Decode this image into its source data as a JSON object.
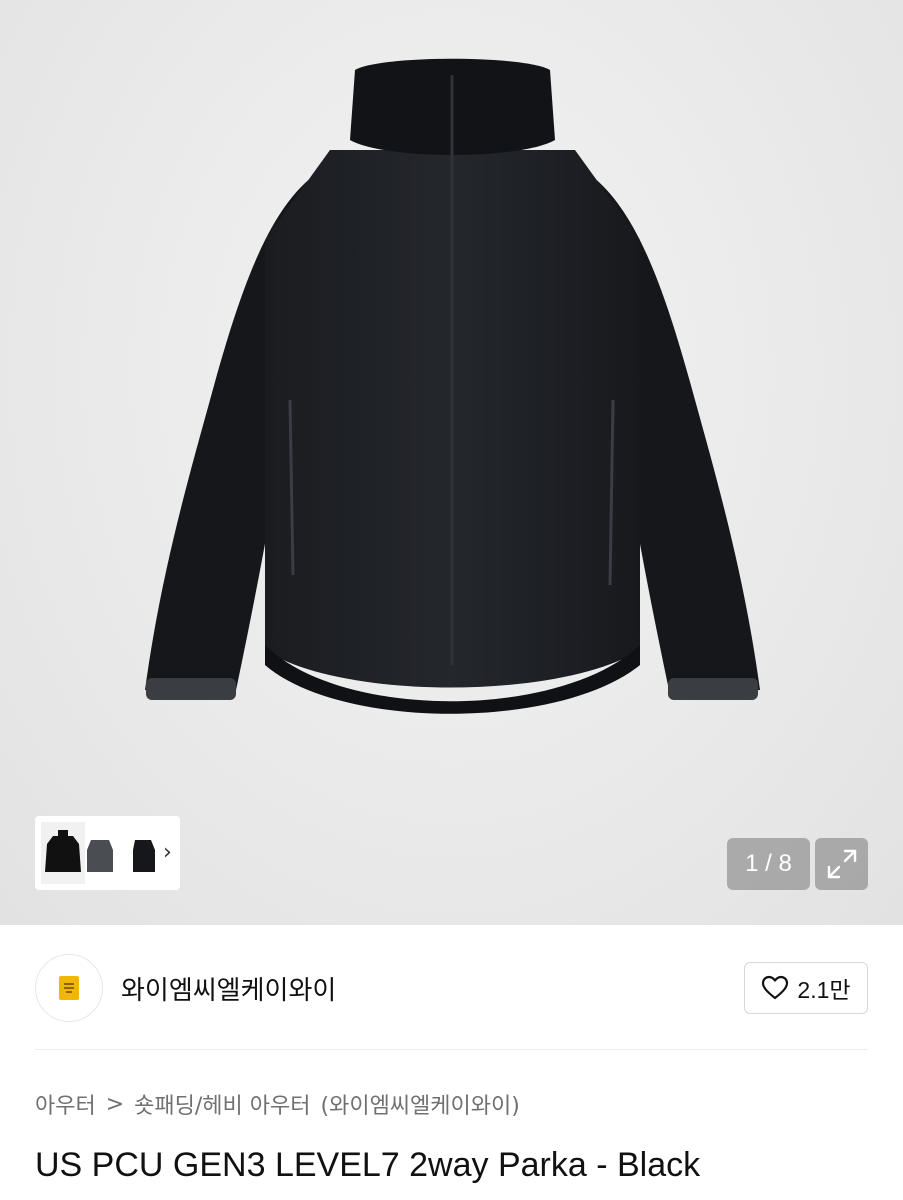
{
  "gallery": {
    "counter": "1 / 8",
    "thumbnails": [
      "jacket-front-thumbnail",
      "jacket-grey-thumbnail",
      "jacket-side-thumbnail"
    ]
  },
  "seller": {
    "name": "와이엠씨엘케이와이",
    "likes": "2.1만"
  },
  "breadcrumb": {
    "category": "아우터",
    "separator": ">",
    "subcategory": "숏패딩/헤비 아우터",
    "brand": "(와이엠씨엘케이와이)"
  },
  "product": {
    "title": "US PCU GEN3 LEVEL7 2way Parka - Black"
  },
  "colors": {
    "logo_yellow": "#f2b705",
    "overlay_grey": "#8a8a8a"
  }
}
